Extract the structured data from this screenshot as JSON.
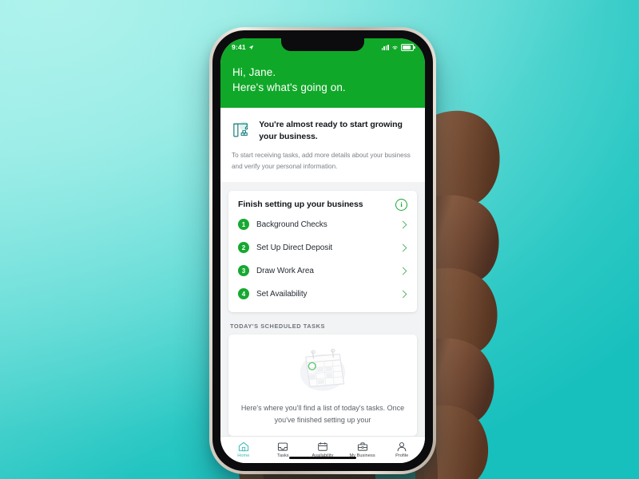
{
  "background": {
    "gradient_from": "#a9efe9",
    "gradient_to": "#18c0bd"
  },
  "theme": {
    "brand_green": "#10a828",
    "accent_green": "#17a832",
    "teal": "#35b8b5",
    "screen_bg": "#f2f3f4"
  },
  "status_bar": {
    "time": "9:41",
    "location_icon": "location-arrow-icon",
    "signal_icon": "cellular-signal-icon",
    "wifi_icon": "wifi-icon",
    "battery_icon": "battery-icon"
  },
  "header": {
    "greeting": "Hi, Jane.",
    "subtitle": "Here's what's going on."
  },
  "banner": {
    "icon": "crane-icon",
    "title": "You're almost ready to start growing your business.",
    "description": "To start receiving tasks, add more details about your business and verify your personal information."
  },
  "setup_card": {
    "title": "Finish setting up your business",
    "info_icon": "info-circle-icon",
    "info_glyph": "i",
    "steps": [
      {
        "number": "1",
        "label": "Background Checks",
        "chevron": "chevron-right-icon"
      },
      {
        "number": "2",
        "label": "Set Up Direct Deposit",
        "chevron": "chevron-right-icon"
      },
      {
        "number": "3",
        "label": "Draw Work Area",
        "chevron": "chevron-right-icon"
      },
      {
        "number": "4",
        "label": "Set Availability",
        "chevron": "chevron-right-icon"
      }
    ]
  },
  "tasks_section": {
    "label": "TODAY'S SCHEDULED TASKS",
    "illustration": "calendar-illustration",
    "empty_text": "Here's where you'll find a list of today's tasks. Once you've finished setting up your"
  },
  "tab_bar": {
    "tabs": [
      {
        "label": "Home",
        "icon": "home-icon",
        "active": true
      },
      {
        "label": "Tasks",
        "icon": "inbox-tray-icon",
        "active": false
      },
      {
        "label": "Availability",
        "icon": "calendar-icon",
        "active": false
      },
      {
        "label": "My Business",
        "icon": "briefcase-icon",
        "active": false
      },
      {
        "label": "Profile",
        "icon": "person-icon",
        "active": false
      }
    ]
  }
}
